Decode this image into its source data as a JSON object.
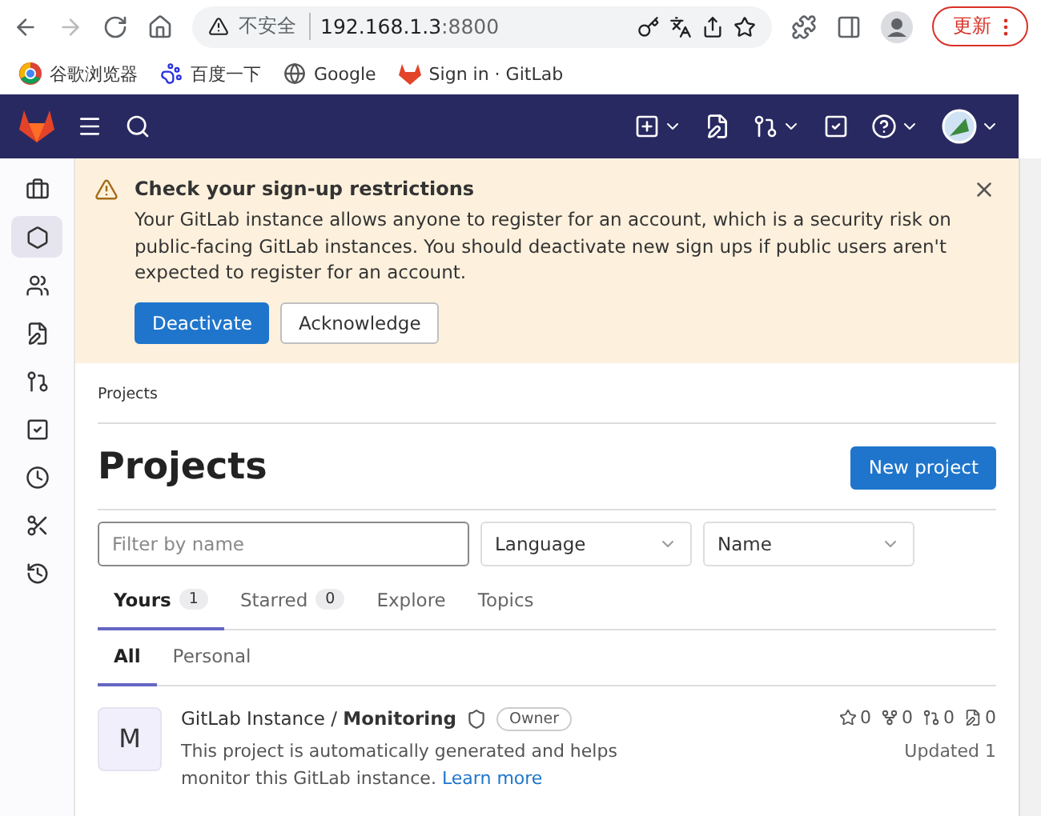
{
  "browser": {
    "security": "不安全",
    "url_host": "192.168.1.3",
    "url_port": ":8800",
    "update_button": "更新"
  },
  "bookmarks": [
    {
      "kind": "chrome",
      "label": "谷歌浏览器"
    },
    {
      "kind": "paw",
      "label": "百度一下"
    },
    {
      "kind": "globe",
      "label": "Google"
    },
    {
      "kind": "fox",
      "label": "Sign in · GitLab"
    }
  ],
  "sidebar": {
    "items": [
      {
        "kind": "briefcase",
        "selected": false
      },
      {
        "kind": "project",
        "selected": true
      },
      {
        "kind": "groups",
        "selected": false
      },
      {
        "kind": "issues",
        "selected": false
      },
      {
        "kind": "merge",
        "selected": false
      },
      {
        "kind": "todo",
        "selected": false
      },
      {
        "kind": "clock",
        "selected": false
      },
      {
        "kind": "snippet",
        "selected": false
      },
      {
        "kind": "history",
        "selected": false
      }
    ]
  },
  "alert": {
    "title": "Check your sign-up restrictions",
    "body": "Your GitLab instance allows anyone to register for an account, which is a security risk on public-facing GitLab instances. You should deactivate new sign ups if public users aren't expected to register for an account.",
    "buttons": [
      {
        "label": "Deactivate",
        "primary": true
      },
      {
        "label": "Acknowledge",
        "primary": false
      }
    ]
  },
  "breadcrumb": "Projects",
  "heading": "Projects",
  "new_button": "New project",
  "filter": {
    "placeholder": "Filter by name"
  },
  "dropdowns": [
    "Language",
    "Name"
  ],
  "tabs": [
    {
      "label": "Yours",
      "count": "1",
      "selected": true
    },
    {
      "label": "Starred",
      "count": "0",
      "selected": false
    },
    {
      "label": "Explore",
      "selected": false
    },
    {
      "label": "Topics",
      "selected": false
    }
  ],
  "subtabs": [
    {
      "label": "All",
      "selected": true
    },
    {
      "label": "Personal",
      "selected": false
    }
  ],
  "project": {
    "avatar": "M",
    "namespace": "GitLab Instance / ",
    "name": "Monitoring",
    "role": "Owner",
    "description": "This project is automatically generated and helps monitor this GitLab instance.",
    "link": "Learn more",
    "stats": [
      {
        "kind": "star",
        "value": "0"
      },
      {
        "kind": "fork",
        "value": "0"
      },
      {
        "kind": "merge",
        "value": "0"
      },
      {
        "kind": "issue",
        "value": "0"
      }
    ],
    "updated": "Updated 1"
  }
}
